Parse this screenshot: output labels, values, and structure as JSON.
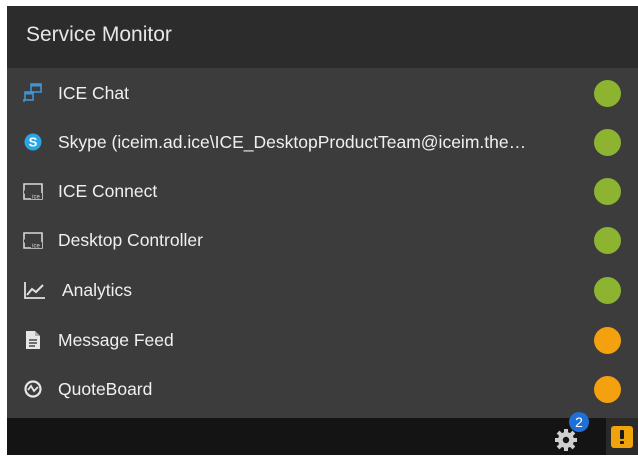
{
  "panel": {
    "title": "Service Monitor"
  },
  "services": [
    {
      "label": "ICE Chat",
      "icon": "chat-windows-icon",
      "status_color": "#8cb431"
    },
    {
      "label": "Skype (iceim.ad.ice\\ICE_DesktopProductTeam@iceim.the…",
      "icon": "skype-icon",
      "status_color": "#8cb431"
    },
    {
      "label": "ICE Connect",
      "icon": "ice-logo-icon",
      "status_color": "#8cb431"
    },
    {
      "label": "Desktop Controller",
      "icon": "ice-logo-icon",
      "status_color": "#8cb431"
    },
    {
      "label": "Analytics",
      "icon": "line-chart-icon",
      "status_color": "#8cb431"
    },
    {
      "label": "Message Feed",
      "icon": "document-icon",
      "status_color": "#f5a00f"
    },
    {
      "label": "QuoteBoard",
      "icon": "quoteboard-icon",
      "status_color": "#f5a00f"
    }
  ],
  "status_bar": {
    "notification_count": "2",
    "gear_icon": "gear-icon",
    "alert_icon": "warning-icon",
    "alert_color": "#f0a30a"
  },
  "colors": {
    "healthy": "#8cb431",
    "warning": "#f5a00f",
    "header_bg": "#2c2c2c",
    "panel_bg": "#3c3c3c",
    "status_bar_bg": "#141414"
  }
}
